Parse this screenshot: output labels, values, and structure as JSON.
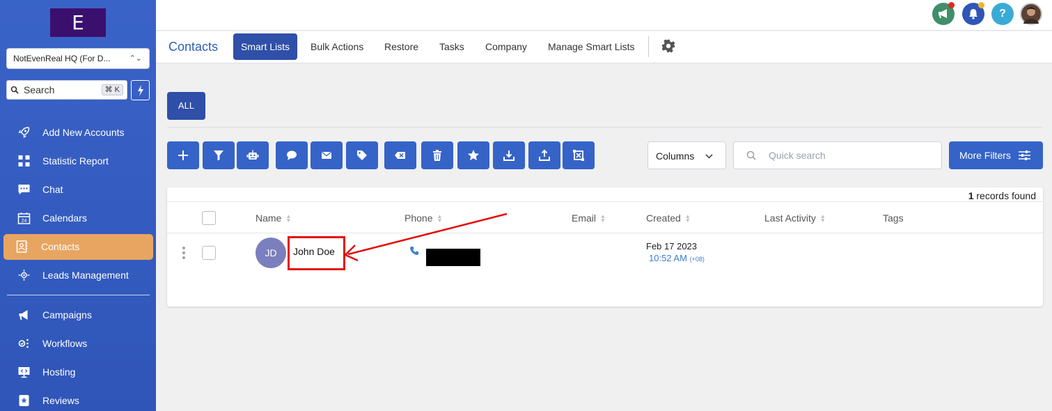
{
  "sidebar": {
    "logo_letter": "E",
    "account": "NotEvenReal HQ (For D...",
    "search_label": "Search",
    "search_shortcut": "⌘ K",
    "items": [
      {
        "label": "Add New Accounts",
        "icon": "rocket-icon"
      },
      {
        "label": "Statistic Report",
        "icon": "dashboard-grid-icon"
      },
      {
        "label": "Chat",
        "icon": "chat-icon"
      },
      {
        "label": "Calendars",
        "icon": "calendar-icon"
      },
      {
        "label": "Contacts",
        "icon": "contacts-icon"
      },
      {
        "label": "Leads Management",
        "icon": "leads-icon"
      }
    ],
    "items2": [
      {
        "label": "Campaigns",
        "icon": "megaphone-icon"
      },
      {
        "label": "Workflows",
        "icon": "workflow-icon"
      },
      {
        "label": "Hosting",
        "icon": "hosting-icon"
      },
      {
        "label": "Reviews",
        "icon": "reviews-icon"
      }
    ]
  },
  "subnav": {
    "title": "Contacts",
    "tabs": [
      "Smart Lists",
      "Bulk Actions",
      "Restore",
      "Tasks",
      "Company",
      "Manage Smart Lists"
    ],
    "active_tab": "Smart Lists"
  },
  "list_filter": "ALL",
  "toolbar": {
    "columns_label": "Columns",
    "quick_search_placeholder": "Quick search",
    "more_filters_label": "More Filters"
  },
  "table": {
    "records_count": "1",
    "records_suffix": " records found",
    "columns": [
      "Name",
      "Phone",
      "Email",
      "Created",
      "Last Activity",
      "Tags"
    ],
    "rows": [
      {
        "initials": "JD",
        "name": "John Doe",
        "created_date": "Feb 17 2023",
        "created_time": "10:52 AM",
        "created_tz": "(+08)"
      }
    ]
  },
  "colors": {
    "sidebar": "#3a63c8",
    "active_nav": "#e7a561",
    "primary_button": "#3563c7",
    "annotation": "#e40e0e"
  }
}
